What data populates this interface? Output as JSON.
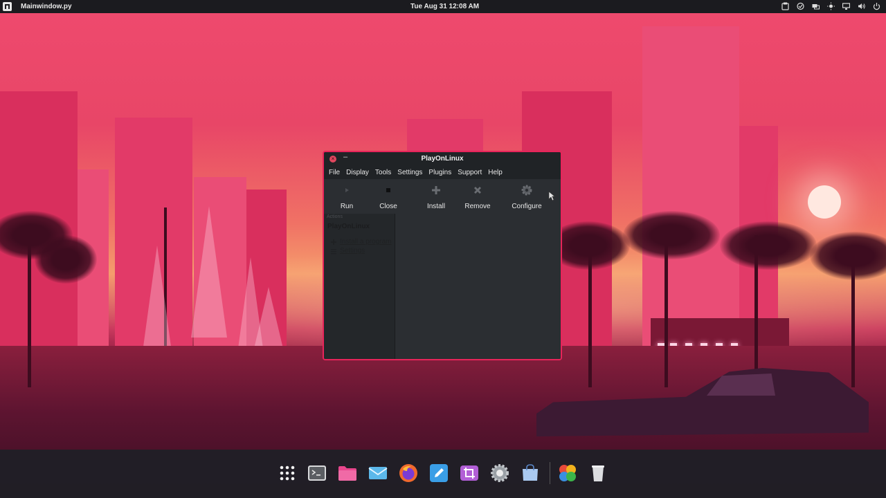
{
  "top_panel": {
    "active_app": "Mainwindow.py",
    "clock": "Tue Aug 31  12:08 AM",
    "tray_icons": [
      "clipboard-icon",
      "check-circle-icon",
      "screens-icon",
      "brightness-icon",
      "display-icon",
      "volume-icon",
      "power-icon"
    ]
  },
  "window": {
    "title": "PlayOnLinux",
    "close_glyph": "×",
    "minimize_glyph": "–",
    "menu": [
      "File",
      "Display",
      "Tools",
      "Settings",
      "Plugins",
      "Support",
      "Help"
    ],
    "toolbar": [
      {
        "label": "Run",
        "icon": "play-icon"
      },
      {
        "label": "Close",
        "icon": "stop-icon"
      },
      {
        "label": "Install",
        "icon": "plus-icon"
      },
      {
        "label": "Remove",
        "icon": "x-icon"
      },
      {
        "label": "Configure",
        "icon": "gear-icon"
      }
    ],
    "sidebar": {
      "caption": "Actions",
      "section_title": "PlayOnLinux",
      "actions": [
        {
          "label": "Install a program",
          "icon": "install-icon"
        },
        {
          "label": "Settings",
          "icon": "settings-icon"
        }
      ]
    },
    "accent_color": "#e8245a"
  },
  "dock": {
    "apps": [
      {
        "name": "App launcher",
        "icon": "grid-icon"
      },
      {
        "name": "Terminal",
        "icon": "terminal-icon"
      },
      {
        "name": "Files",
        "icon": "folder-icon"
      },
      {
        "name": "Mail",
        "icon": "mail-icon"
      },
      {
        "name": "Firefox",
        "icon": "firefox-icon"
      },
      {
        "name": "Text editor",
        "icon": "edit-icon"
      },
      {
        "name": "Screenshot",
        "icon": "screenshot-icon"
      },
      {
        "name": "Settings",
        "icon": "settings-icon"
      },
      {
        "name": "Store",
        "icon": "store-icon"
      },
      {
        "name": "PlayOnLinux",
        "icon": "playonlinux-icon"
      },
      {
        "name": "Trash",
        "icon": "trash-icon"
      }
    ]
  }
}
